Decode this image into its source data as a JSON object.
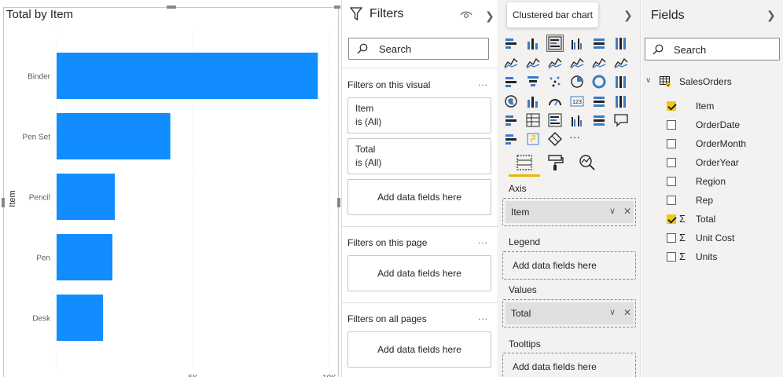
{
  "visual": {
    "title": "Total by Item"
  },
  "chart_data": {
    "type": "bar",
    "orientation": "horizontal",
    "title": "Total by Item",
    "ylabel": "Item",
    "xlabel": "",
    "categories": [
      "Binder",
      "Pen Set",
      "Pencil",
      "Pen",
      "Desk"
    ],
    "values": [
      9577,
      4169,
      2135,
      2045,
      1700
    ],
    "xlim": [
      0,
      10000
    ],
    "x_ticks": [
      "5K",
      "10K"
    ],
    "x_tick_values": [
      5000,
      10000
    ],
    "color": "#118DFF",
    "grid": true
  },
  "filters": {
    "title": "Filters",
    "search_placeholder": "Search",
    "on_visual_label": "Filters on this visual",
    "on_visual_cards": [
      {
        "name": "Item",
        "value": "is (All)"
      },
      {
        "name": "Total",
        "value": "is (All)"
      }
    ],
    "add_fields": "Add data fields here",
    "on_page_label": "Filters on this page",
    "on_all_pages_label": "Filters on all pages",
    "more": "..."
  },
  "visualizations": {
    "tooltip": "Clustered bar chart",
    "wells": {
      "axis_label": "Axis",
      "axis_field": "Item",
      "legend_label": "Legend",
      "values_label": "Values",
      "values_field": "Total",
      "tooltips_label": "Tooltips",
      "add_fields": "Add data fields here"
    },
    "more": "···"
  },
  "fields": {
    "title": "Fields",
    "search_placeholder": "Search",
    "table_name": "SalesOrders",
    "items": [
      {
        "name": "Item",
        "checked": true,
        "sigma": false
      },
      {
        "name": "OrderDate",
        "checked": false,
        "sigma": false
      },
      {
        "name": "OrderMonth",
        "checked": false,
        "sigma": false
      },
      {
        "name": "OrderYear",
        "checked": false,
        "sigma": false
      },
      {
        "name": "Region",
        "checked": false,
        "sigma": false
      },
      {
        "name": "Rep",
        "checked": false,
        "sigma": false
      },
      {
        "name": "Total",
        "checked": true,
        "sigma": true
      },
      {
        "name": "Unit Cost",
        "checked": false,
        "sigma": true
      },
      {
        "name": "Units",
        "checked": false,
        "sigma": true
      }
    ]
  },
  "colors": {
    "accent": "#F2C811",
    "bar": "#118DFF"
  }
}
